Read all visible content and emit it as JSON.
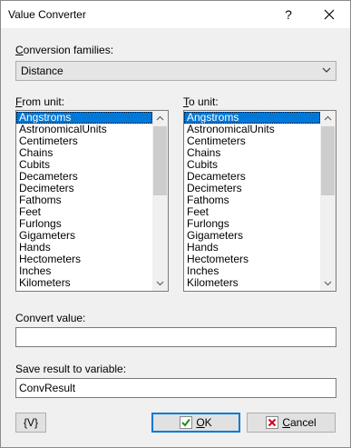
{
  "window": {
    "title": "Value Converter",
    "help_label": "?"
  },
  "families": {
    "label_accel": "C",
    "label_rest": "onversion families:",
    "selected": "Distance"
  },
  "from_unit": {
    "label_accel": "F",
    "label_rest": "rom unit:",
    "selected_index": 0,
    "items": [
      "Angstroms",
      "AstronomicalUnits",
      "Centimeters",
      "Chains",
      "Cubits",
      "Decameters",
      "Decimeters",
      "Fathoms",
      "Feet",
      "Furlongs",
      "Gigameters",
      "Hands",
      "Hectometers",
      "Inches",
      "Kilometers"
    ]
  },
  "to_unit": {
    "label_accel": "T",
    "label_rest": "o unit:",
    "selected_index": 0,
    "items": [
      "Angstroms",
      "AstronomicalUnits",
      "Centimeters",
      "Chains",
      "Cubits",
      "Decameters",
      "Decimeters",
      "Fathoms",
      "Feet",
      "Furlongs",
      "Gigameters",
      "Hands",
      "Hectometers",
      "Inches",
      "Kilometers"
    ]
  },
  "convert_value": {
    "label": "Convert value:",
    "value": ""
  },
  "save_result": {
    "label": "Save result to variable:",
    "value": "ConvResult"
  },
  "buttons": {
    "variables_label": "{V}",
    "ok_accel": "O",
    "ok_rest": "K",
    "cancel_accel": "C",
    "cancel_rest": "ancel"
  },
  "colors": {
    "selection": "#0078d7",
    "ok_icon": "#1a8f1a",
    "cancel_icon": "#d0021b"
  }
}
